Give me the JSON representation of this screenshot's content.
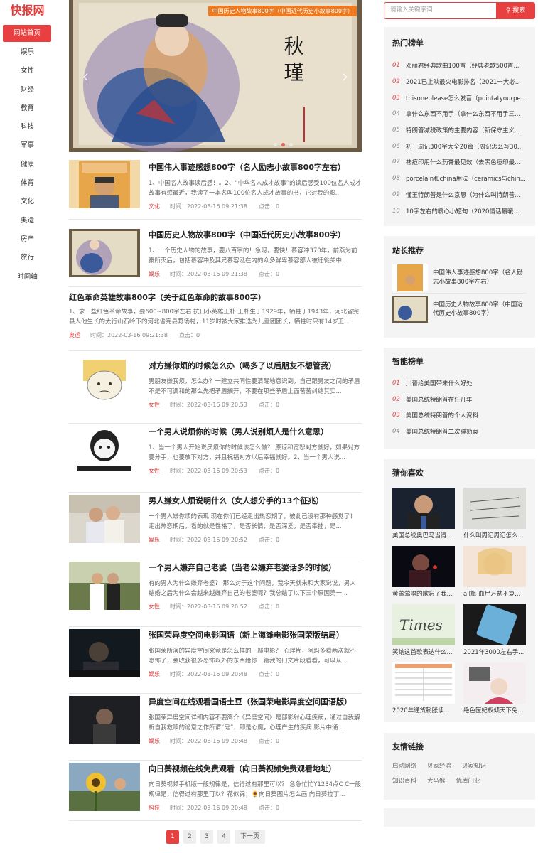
{
  "logo": "快报网",
  "nav": [
    "网站首页",
    "娱乐",
    "女性",
    "财经",
    "教育",
    "科技",
    "军事",
    "健康",
    "体育",
    "文化",
    "奥运",
    "房产",
    "旅行",
    "时间轴"
  ],
  "slider": {
    "tag": "中国历史人物故事800字（中国近代历史小故事800字）",
    "prev_icon": "‹",
    "next_icon": "›",
    "painting_text": "秋 瑾"
  },
  "articles": [
    {
      "title": "中国伟人事迹感想800字（名人励志小故事800字左右）",
      "desc": "1、中国名人故事读后感！。2、“中华名人成才故事”的读后感受100位名人成才故事有感最近，我读了一本名叫100位名人成才故事的书，它对我的影...",
      "cat": "文化",
      "time": "时间：2022-03-16 09:21:38",
      "clicks": "点击：0"
    },
    {
      "title": "中国历史人物故事800字（中国近代历史小故事800字）",
      "desc": "1、一个历史人物的故事，要八百字的！急呀，要快！慕容冲370年，前燕为前秦所灭后，包括慕容冲及其兄慕容泓在内的众多鲜卑慕容部人被迁徙关中...",
      "cat": "娱乐",
      "time": "时间：2022-03-16 09:21:38",
      "clicks": "点击：0"
    },
    {
      "title": "红色革命英雄故事800字（关于红色革命的故事800字）",
      "desc": "1、求一些红色革命故事，要600~800字左右 抗日小英雄王朴 王朴生于1929年，牺牲于1943年，河北省完县人他生长的太行山石岭下的河北省完县野场村，11岁时被大家推选为儿童团团长，牺牲时只有14岁王...",
      "cat": "奥运",
      "time": "时间：2022-03-16 09:21:38",
      "clicks": "点击：0"
    },
    {
      "title": "对方嫌你烦的时候怎么办（喝多了以后朋友不想管我）",
      "desc": "男朋友嫌我烦，怎么办？一建立共同性要清醒地意识到，自己跟男友之间的矛盾不是不可调和的那么先把矛盾搁开，不要在那些矛盾上面苦苦纠结其实...",
      "cat": "女性",
      "time": "时间：2022-03-16 09:20:53",
      "clicks": "点击：0"
    },
    {
      "title": "一个男人说烦你的时候（男人说别烦人是什么意思）",
      "desc": "1、当一个男人开始说厌烦你的时候该怎么做？ 原谅和宽恕对方就好，如果对方要分手，也要放下对方，并且祝福对方以后幸福就好。2、当一个男人说...",
      "cat": "女性",
      "time": "时间：2022-03-16 09:20:53",
      "clicks": "点击：0"
    },
    {
      "title": "男人嫌女人烦说明什么（女人想分手的13个征兆）",
      "desc": "一个男人嫌你烦的表现 现在你们已经走出热恋期了，彼此已没有那种感觉了！走出热恋期后，看的就是性格了，是否长情，是否深爱，是否牵挂，是...",
      "cat": "娱乐",
      "time": "时间：2022-03-16 09:20:52",
      "clicks": "点击：0"
    },
    {
      "title": "一个男人嫌弃自己老婆（当老公嫌弃老婆话多的时候）",
      "desc": "有的男人为什么嫌弃老婆？ 那么对于这个问题，我今天就来和大家说说，男人结婚之后为什么会越来越嫌弃自己的老婆呢？我总结了以下三个原因第一...",
      "cat": "女性",
      "time": "时间：2022-03-16 09:20:52",
      "clicks": "点击：0"
    },
    {
      "title": "张国荣异度空间电影国语（新上海滩电影张国荣版结局）",
      "desc": "张国荣所演的异度空间究竟是怎么样的一部电影？ 心理片，阿玛多看两次就不恐怖了，会收获很多恐怖以外的东西给你一篇我的旧文片段看看，可以从...",
      "cat": "娱乐",
      "time": "时间：2022-03-16 09:20:48",
      "clicks": "点击：0"
    },
    {
      "title": "异度空间在线观看国语土豆（张国荣电影异度空间国语版）",
      "desc": "张国荣异度空间详细内容不要简介《异度空间》是部影射心理疾病，通过自我解析自我救赎的诡意之作所谓“鬼”，即是心魔，心理产生的疾病 影片中通...",
      "cat": "娱乐",
      "time": "时间：2022-03-16 09:20:48",
      "clicks": "点击：0"
    },
    {
      "title": "向日葵视频在线免费观看（向日葵视频免费观看地址）",
      "desc": "向日葵视频手机版一般规律是，信得过有那里可以？ 急急忙忙Y1234点C C一般规律是，信得过有那里可以？花似锦；🌻向日葵图片怎么画 向日葵拉丁...",
      "cat": "科技",
      "time": "时间：2022-03-16 09:20:48",
      "clicks": "点击：0"
    }
  ],
  "pagination": [
    "1",
    "2",
    "3",
    "4",
    "下一页"
  ],
  "search": {
    "placeholder": "请输入关键字词",
    "button": "搜索"
  },
  "hot_rank": {
    "title": "热门榜单",
    "items": [
      {
        "num": "01",
        "text": "邓丽君经典歌曲100首（经典老歌500首..."
      },
      {
        "num": "02",
        "text": "2021已上映最火电影排名（2021十大必..."
      },
      {
        "num": "03",
        "text": "thisoneplease怎么发音（pointatyourpe..."
      },
      {
        "num": "04",
        "text": "拿什么东西不用手（拿什么东西不用手三..."
      },
      {
        "num": "05",
        "text": "特朗普减税政策的主要内容（新保守主义..."
      },
      {
        "num": "06",
        "text": "初一周记300字大全20篇（周记怎么写30..."
      },
      {
        "num": "07",
        "text": "祛痘印用什么药膏最见效（去黑色痘印最..."
      },
      {
        "num": "08",
        "text": "porcelain和china用法（ceramics与chin..."
      },
      {
        "num": "09",
        "text": "懂王特朗普是什么意思（为什么叫特朗普..."
      },
      {
        "num": "10",
        "text": "10字左右的暖心小短句（2020情话最暖..."
      }
    ]
  },
  "recommend": {
    "title": "站长推荐",
    "items": [
      {
        "text": "中国伟人事迹感想800字（名人励志小故事800字左右）"
      },
      {
        "text": "中国历史人物故事800字（中国近代历史小故事800字）"
      }
    ]
  },
  "smart_rank": {
    "title": "智能榜单",
    "items": [
      {
        "num": "01",
        "text": "川普给美国带来什么好处"
      },
      {
        "num": "02",
        "text": "美国总统特朗普在任几年"
      },
      {
        "num": "03",
        "text": "美国总统特朗普的个人资料"
      },
      {
        "num": "04",
        "text": "美国总统特朗普二次弹劾案"
      }
    ]
  },
  "guess": {
    "title": "猜你喜欢",
    "items": [
      {
        "caption": "美国总统奥巴马当得..."
      },
      {
        "caption": "什么叫周记周记怎么..."
      },
      {
        "caption": "黄莺莺唱的歌忘了我..."
      },
      {
        "caption": "all瓶 血尸万劫不复..."
      },
      {
        "caption": "笑纳这首歌表达什么..."
      },
      {
        "caption": "2021年3000左右手..."
      },
      {
        "caption": "2020年通货膨胀读..."
      },
      {
        "caption": "绝色医妃权倾天下免..."
      }
    ]
  },
  "friend_links": {
    "title": "友情链接",
    "items": [
      "启动网络",
      "贝家经验",
      "贝家知识",
      "知识百科",
      "大马猴",
      "优库门业"
    ]
  }
}
